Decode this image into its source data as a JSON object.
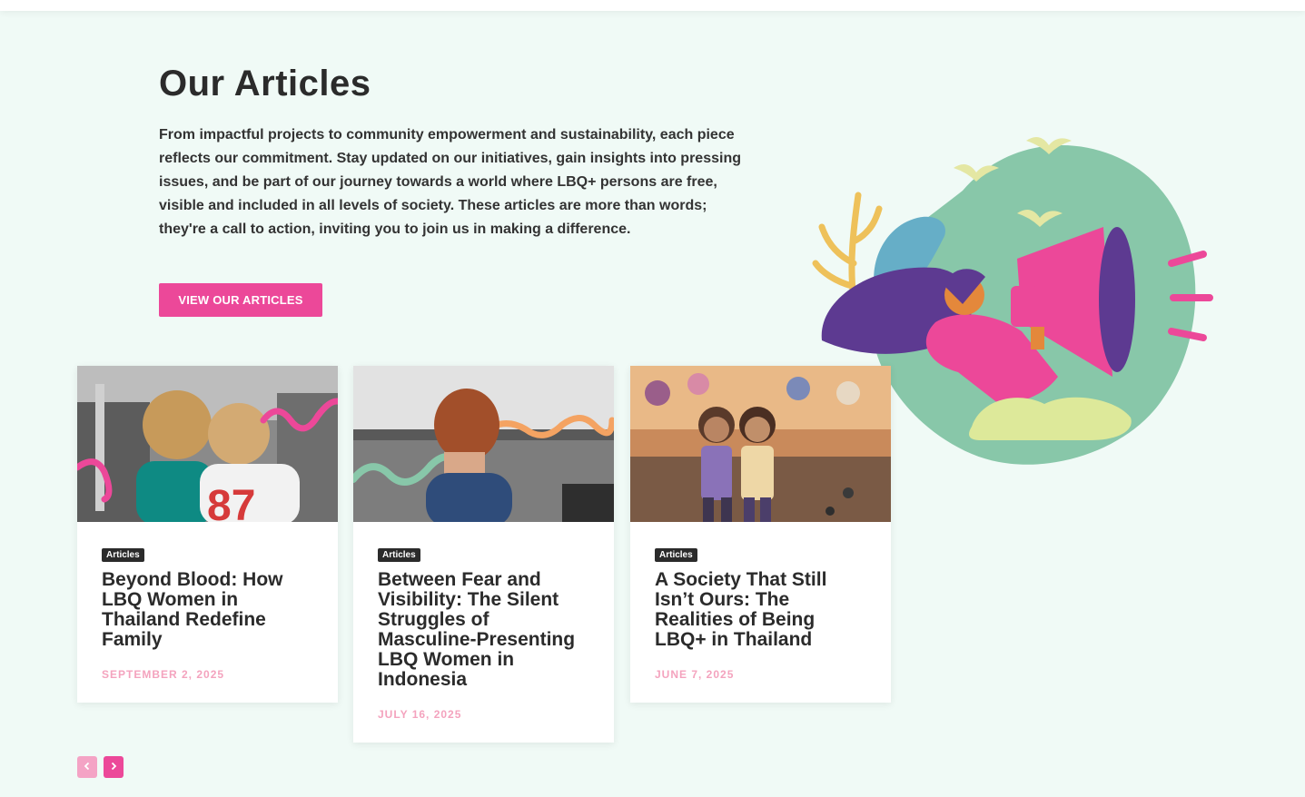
{
  "section": {
    "title": "Our Articles",
    "intro": "From impactful projects to community empowerment and sustainability, each piece reflects our commitment. Stay updated on our initiatives, gain insights into pressing issues, and be part of our journey towards a world where LBQ+ persons are free, visible and included in all levels of society. These articles are more than words; they're a call to action, inviting you to join us in making a difference.",
    "cta_label": "VIEW OUR ARTICLES"
  },
  "articles": [
    {
      "tag": "Articles",
      "title": "Beyond Blood: How LBQ Women in Thailand Redefine Family",
      "date": "SEPTEMBER 2, 2025"
    },
    {
      "tag": "Articles",
      "title": "Between Fear and Visibility: The Silent Struggles of Masculine-Presenting LBQ Women in Indonesia",
      "date": "JULY 16, 2025"
    },
    {
      "tag": "Articles",
      "title": "A Society That Still Isn’t Ours: The Realities of Being LBQ+ in Thailand",
      "date": "JUNE 7, 2025"
    }
  ],
  "carousel": {
    "prev_icon": "chevron-left-icon",
    "next_icon": "chevron-right-icon"
  },
  "colors": {
    "accent": "#ec4899",
    "accent_light": "#f4a3c5",
    "background": "#f0faf6",
    "date": "#f4a3be"
  }
}
